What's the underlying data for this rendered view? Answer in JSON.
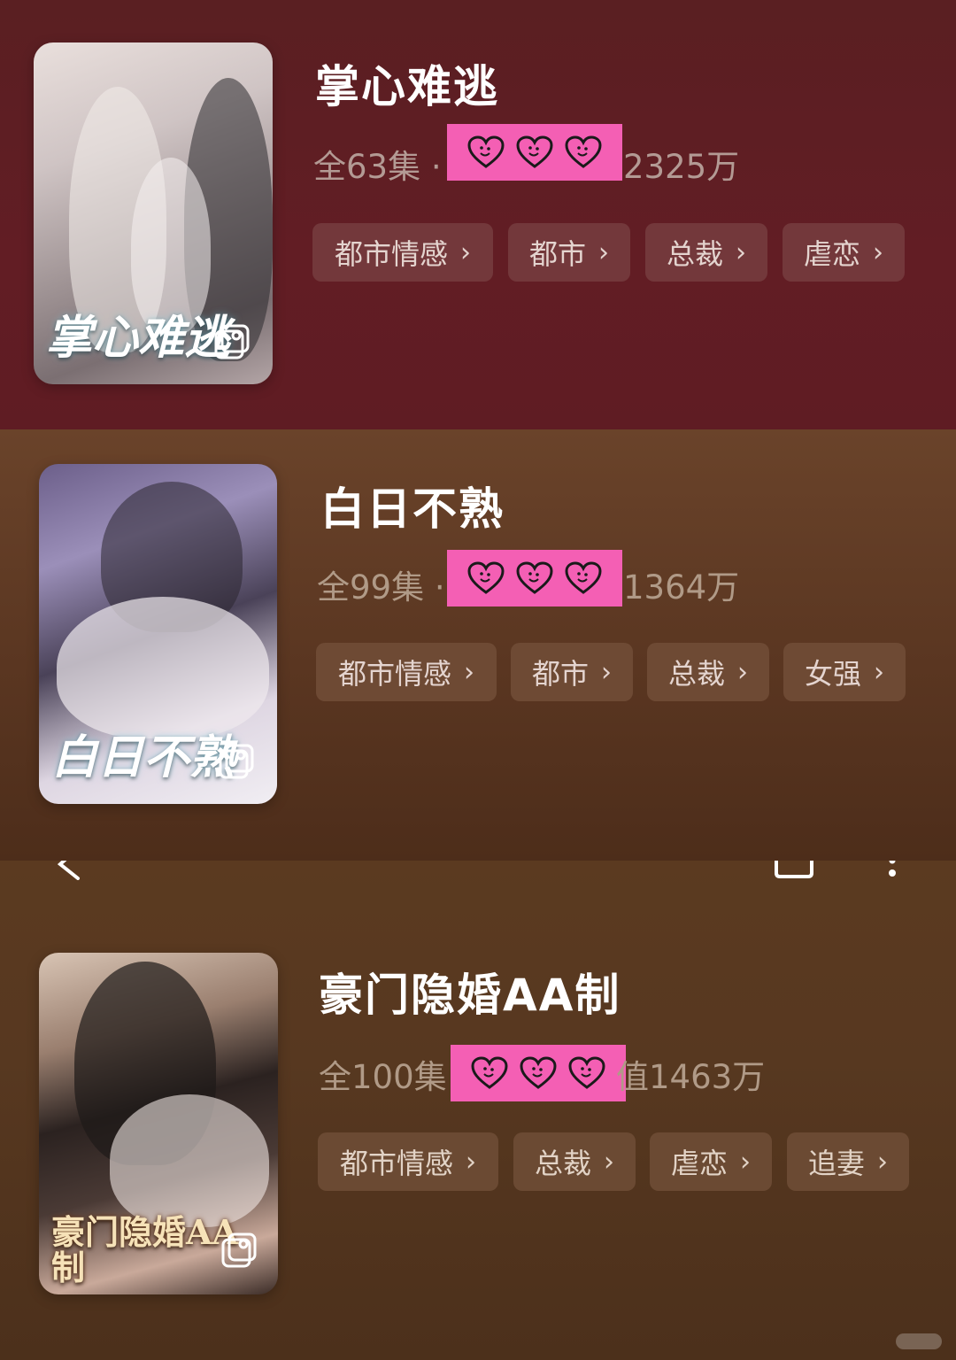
{
  "items": [
    {
      "title": "掌心难逃",
      "episodes": "全63集",
      "separator": "·",
      "views": "2325万",
      "poster_text": "掌心难逃",
      "tags": [
        {
          "label": "都市情感"
        },
        {
          "label": "都市"
        },
        {
          "label": "总裁"
        },
        {
          "label": "虐恋"
        }
      ]
    },
    {
      "title": "白日不熟",
      "episodes": "全99集",
      "separator": "·",
      "views": "1364万",
      "poster_text": "白日不熟",
      "tags": [
        {
          "label": "都市情感"
        },
        {
          "label": "都市"
        },
        {
          "label": "总裁"
        },
        {
          "label": "女强"
        }
      ]
    },
    {
      "title": "豪门隐婚AA制",
      "episodes": "全100集",
      "separator": "",
      "views": "1463万",
      "views_prefix": "值",
      "poster_text": "豪门隐婚AA制",
      "tags": [
        {
          "label": "都市情感"
        },
        {
          "label": "总裁"
        },
        {
          "label": "虐恋"
        },
        {
          "label": "追妻"
        }
      ]
    }
  ],
  "tag_chevron": "›",
  "icons": {
    "censor_sticker": "heart-face-icon",
    "poster_badge": "gallery-icon",
    "top_bar": [
      "back-arrow-icon",
      "window-icon",
      "more-vertical-icon"
    ]
  },
  "colors": {
    "censor": "#f45fb4",
    "section_1_bg": "#5f1c23",
    "section_2_bg": "#5a3621",
    "section_3_bg": "#573820"
  }
}
